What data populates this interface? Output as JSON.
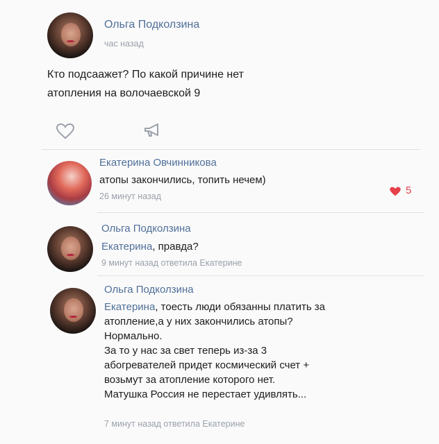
{
  "post": {
    "author": "Ольга Подколзина",
    "time": "час назад",
    "text_line1": "Кто подсаажет? По какой причине нет",
    "text_line2": "атопления на волочаевской 9"
  },
  "comments": [
    {
      "author": "Екатерина Овчинникова",
      "text": "атопы закончились, топить нечем)",
      "time": "26 минут назад",
      "likes": "5"
    },
    {
      "author": "Ольга Подколзина",
      "mention": "Екатерина",
      "text": ", правда?",
      "time": "9 минут назад ответила Екатерине"
    },
    {
      "author": "Ольга Подколзина",
      "mention": "Екатерина",
      "line1": ", тоесть люди обязанны платить за",
      "line2": "атопление,а у них закончились атопы?",
      "line3": "Нормально.",
      "line4": "За то у нас за свет теперь из-за 3",
      "line5": "абогревателей придет космический счет +",
      "line6": "возьмут за атопление которого нет.",
      "line7": "Матушка Россия не перестает удивлять...",
      "time": "7 минут назад ответила Екатерине"
    }
  ],
  "icons": {
    "like": "heart-icon",
    "share": "megaphone-icon",
    "liked": "heart-filled-icon"
  }
}
